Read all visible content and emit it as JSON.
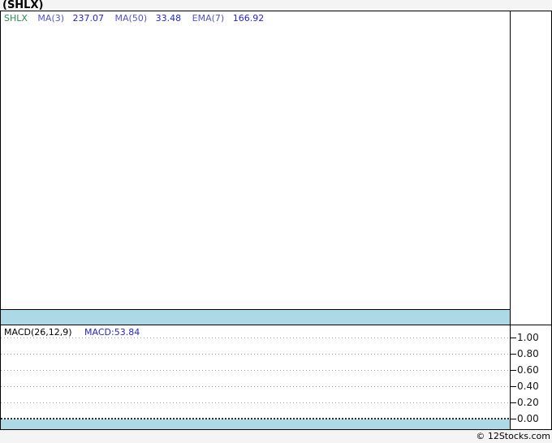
{
  "page": {
    "background": "#f4f4f4",
    "copyright": "© 12Stocks.com"
  },
  "title": "(SHLX)",
  "colors": {
    "ticker_green": "#2e8b57",
    "indicator_label_blue": "#5353cc",
    "indicator_value_blue": "#2424dd",
    "band_blue": "#add8e6",
    "border_black": "#000000",
    "gridline_gray": "#999999",
    "axis_text": "#151515",
    "panel_background": "#ffffff"
  },
  "main_chart": {
    "ticker": "SHLX",
    "indicators": [
      {
        "label": "MA(3)",
        "value": "237.07"
      },
      {
        "label": "MA(50)",
        "value": "33.48"
      },
      {
        "label": "EMA(7)",
        "value": "166.92"
      }
    ]
  },
  "macd_panel": {
    "legend_label": "MACD(26,12,9)",
    "legend_value": "MACD:53.84",
    "axis_ticks": [
      "1.00",
      "0.80",
      "0.60",
      "0.40",
      "0.20",
      "0.00"
    ]
  },
  "chart_data": [
    {
      "type": "line",
      "title": "(SHLX) price panel",
      "legend": [
        "SHLX",
        "MA(3) = 237.07",
        "MA(50) = 33.48",
        "EMA(7) = 166.92"
      ],
      "series": [],
      "note": "plot area rendered empty (no visible price data); light-blue band strip at bottom of panel"
    },
    {
      "type": "line",
      "title": "MACD(26,12,9)",
      "legend": [
        "MACD:53.84"
      ],
      "yticks": [
        1.0,
        0.8,
        0.6,
        0.4,
        0.2,
        0.0
      ],
      "ylim": [
        0.0,
        1.0
      ],
      "grid": "dotted horizontal gridlines, dense dotted zero line",
      "legend_position": "top-left",
      "axis_position": "right",
      "series": [],
      "note": "plot area rendered empty (no visible MACD histogram/lines); light-blue band strip at bottom of panel"
    }
  ]
}
